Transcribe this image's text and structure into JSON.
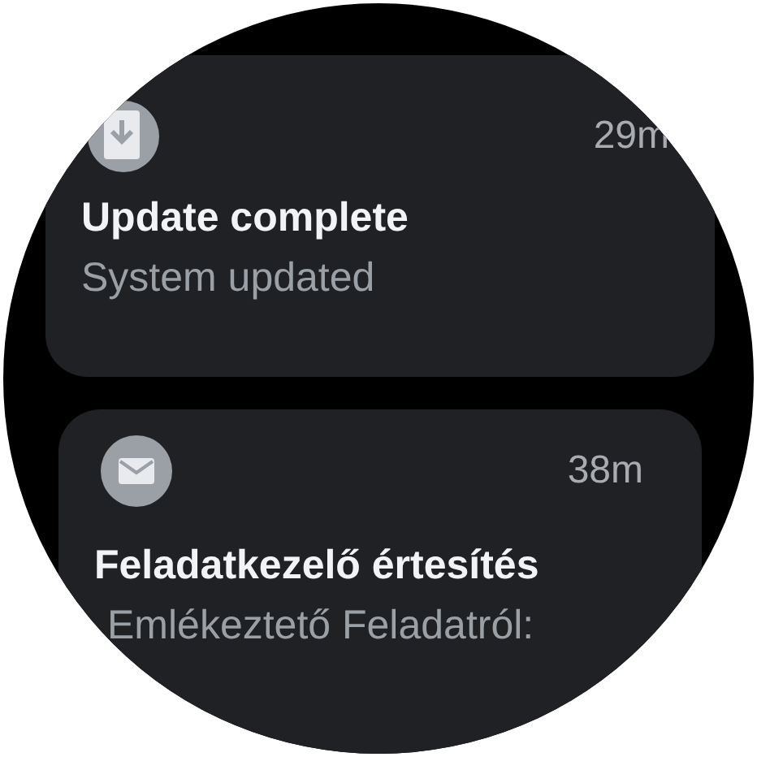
{
  "notifications": [
    {
      "time": "29m",
      "title": "Update complete",
      "text": "System updated"
    },
    {
      "time": "38m",
      "title": "Feladatkezelő értesítés",
      "text": "Emlékeztető Feladatról:"
    }
  ]
}
